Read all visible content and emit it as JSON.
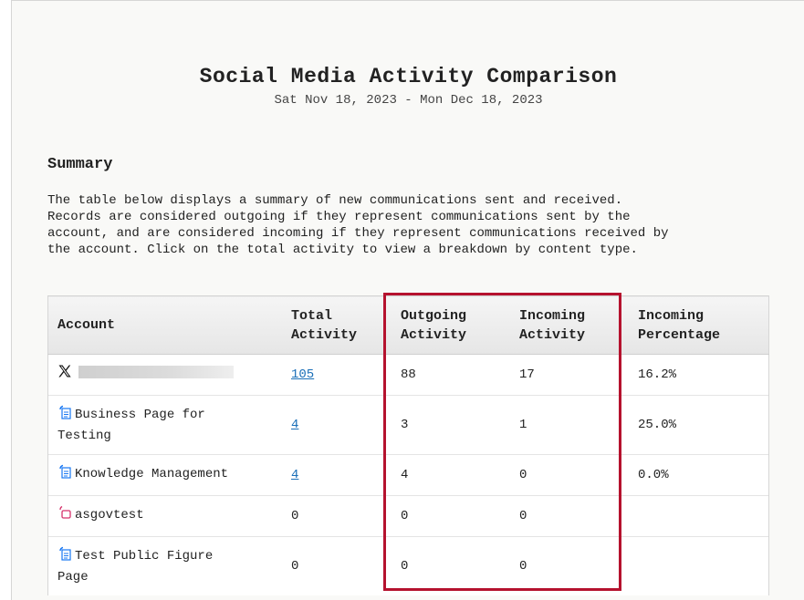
{
  "report": {
    "title": "Social Media Activity Comparison",
    "date_range": "Sat Nov 18, 2023 - Mon Dec 18, 2023"
  },
  "summary": {
    "heading": "Summary",
    "description": "The table below displays a summary of new communications sent and received.\nRecords are considered outgoing if they represent communications sent by the\naccount, and are considered incoming if they represent communications received by\nthe account. Click on the total activity to view a breakdown by content type."
  },
  "table": {
    "headers": {
      "account": "Account",
      "total": "Total\nActivity",
      "outgoing": "Outgoing\nActivity",
      "incoming": "Incoming\nActivity",
      "percentage": "Incoming\nPercentage"
    },
    "rows": [
      {
        "icon": "x-logo-icon",
        "account": "",
        "total": "105",
        "outgoing": "88",
        "incoming": "17",
        "percentage": "16.2%"
      },
      {
        "icon": "facebook-page-icon",
        "account": "Business Page for\nTesting",
        "total": "4",
        "outgoing": "3",
        "incoming": "1",
        "percentage": "25.0%"
      },
      {
        "icon": "facebook-page-icon",
        "account": "Knowledge Management",
        "total": "4",
        "outgoing": "4",
        "incoming": "0",
        "percentage": "0.0%"
      },
      {
        "icon": "instagram-icon",
        "account": "asgovtest",
        "total": "0",
        "outgoing": "0",
        "incoming": "0",
        "percentage": ""
      },
      {
        "icon": "facebook-page-icon",
        "account": "Test Public Figure\nPage",
        "total": "0",
        "outgoing": "0",
        "incoming": "0",
        "percentage": ""
      }
    ]
  },
  "colors": {
    "highlight_border": "#b5122e",
    "link": "#1a6fb8",
    "facebook_icon": "#1877f2",
    "instagram_icon": "#d6336c"
  }
}
